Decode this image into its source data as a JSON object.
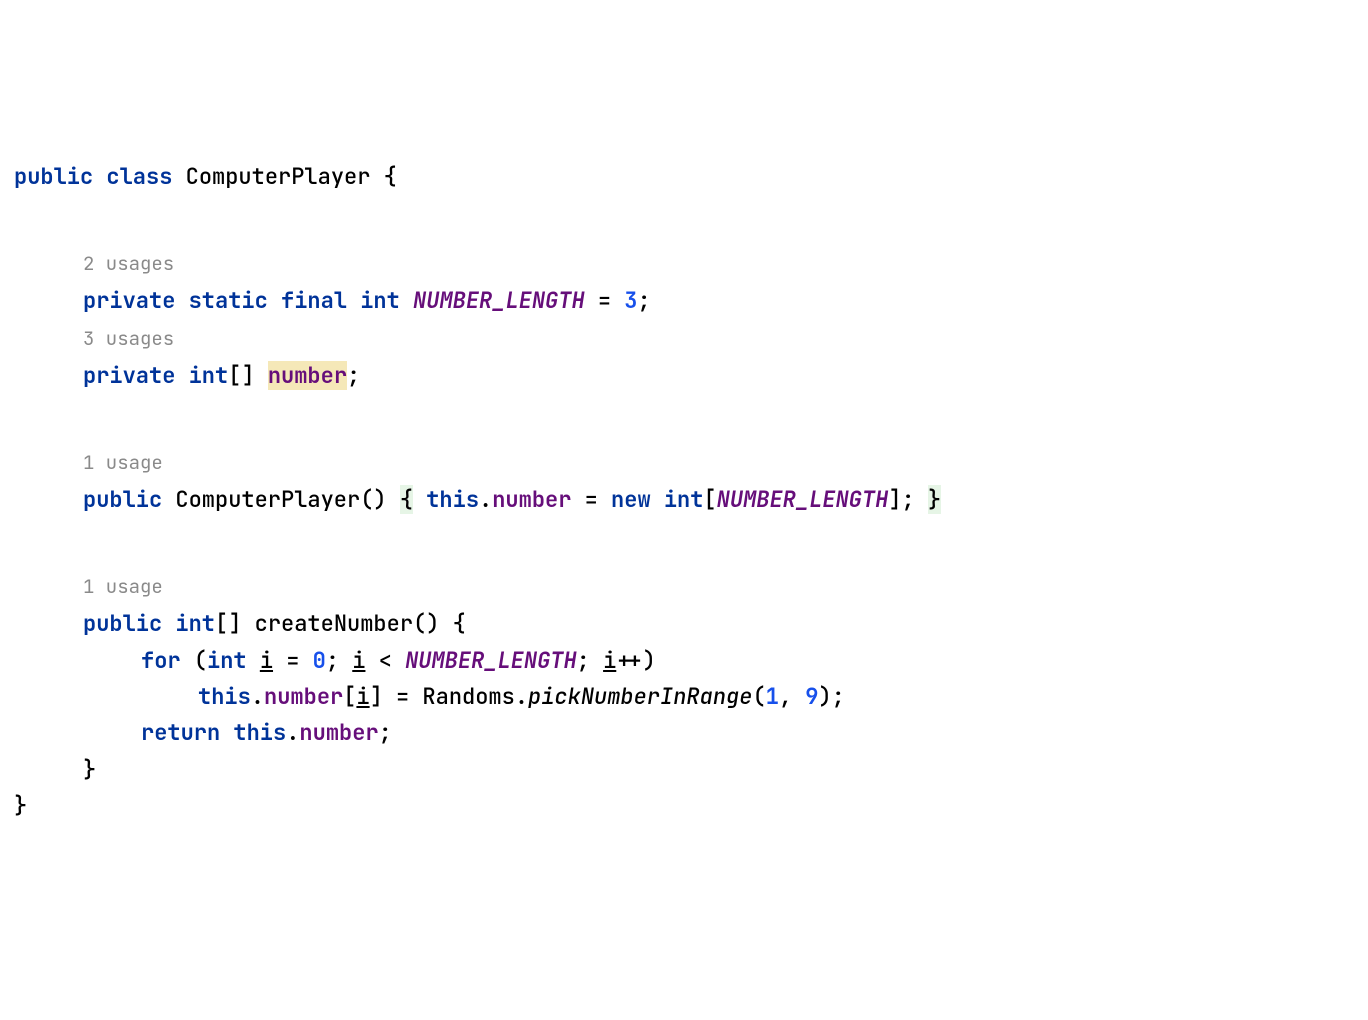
{
  "code": {
    "line1_public": "public",
    "line1_class": "class",
    "line1_name": "ComputerPlayer",
    "line1_brace": " {",
    "usage1": "2 usages",
    "line2_private": "private",
    "line2_static": "static",
    "line2_final": "final",
    "line2_int": "int",
    "line2_const": "NUMBER_LENGTH",
    "line2_eq": " = ",
    "line2_val": "3",
    "line2_semi": ";",
    "usage2": "3 usages",
    "line3_private": "private",
    "line3_int": "int",
    "line3_brackets": "[] ",
    "line3_field": "number",
    "line3_semi": ";",
    "usage3": "1 usage",
    "line4_public": "public",
    "line4_name": " ComputerPlayer() ",
    "line4_brace1": "{",
    "line4_this": "this",
    "line4_dot": ".",
    "line4_field": "number",
    "line4_eq": " = ",
    "line4_new": "new",
    "line4_int": "int",
    "line4_br1": "[",
    "line4_const": "NUMBER_LENGTH",
    "line4_br2": "]; ",
    "line4_brace2": "}",
    "usage4": "1 usage",
    "line5_public": "public",
    "line5_int": "int",
    "line5_brackets": "[] createNumber() {",
    "line6_for": "for",
    "line6_paren": " (",
    "line6_int": "int",
    "line6_sp": " ",
    "line6_i1": "i",
    "line6_eq": " = ",
    "line6_zero": "0",
    "line6_semi1": "; ",
    "line6_i2": "i",
    "line6_lt": " < ",
    "line6_const": "NUMBER_LENGTH",
    "line6_semi2": "; ",
    "line6_i3": "i",
    "line6_inc": "++)",
    "line7_this": "this",
    "line7_dot": ".",
    "line7_field": "number",
    "line7_br1": "[",
    "line7_i": "i",
    "line7_br2": "] = Randoms.",
    "line7_method": "pickNumberInRange",
    "line7_paren1": "(",
    "line7_arg1": "1",
    "line7_comma": ", ",
    "line7_arg2": "9",
    "line7_paren2": ");",
    "line8_return": "return",
    "line8_sp": " ",
    "line8_this": "this",
    "line8_dot": ".",
    "line8_field": "number",
    "line8_semi": ";",
    "line9_brace": "}",
    "line10_brace": "}"
  }
}
